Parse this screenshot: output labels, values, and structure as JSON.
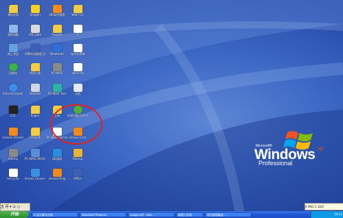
{
  "desktop_icons": [
    {
      "label": "我的文档",
      "icon": "folder-icon",
      "color": "#f2cd43"
    },
    {
      "label": "Qingdin",
      "icon": "app-icon",
      "color": "#f4d21f"
    },
    {
      "label": "360软件管家",
      "icon": "app-icon",
      "color": "#f58b1f"
    },
    {
      "label": "WIN7-CE",
      "icon": "folder-icon",
      "color": "#f2cd43"
    },
    {
      "label": "我的电脑",
      "icon": "computer-icon",
      "color": "#8fb8ee"
    },
    {
      "label": "VID_Data",
      "icon": "app-icon",
      "color": "#d9d9d9"
    },
    {
      "label": "Scopeie",
      "icon": "folder-icon",
      "color": "#f2cd43"
    },
    {
      "label": "2",
      "icon": "document-icon",
      "color": "#ffffff"
    },
    {
      "label": "网上邻居",
      "icon": "network-icon",
      "color": "#67a1e0"
    },
    {
      "label": "印刷车间管理工具",
      "icon": "app-icon",
      "color": "#3e5fb6"
    },
    {
      "label": "Bluetooth",
      "icon": "bluetooth-icon",
      "color": "#2f6fd8"
    },
    {
      "label": "xp中文简体",
      "icon": "document-icon",
      "color": "#ffffff"
    },
    {
      "label": "回收站",
      "icon": "recycle-bin-icon",
      "color": "#3cb34a"
    },
    {
      "label": "实用工具",
      "icon": "folder-icon",
      "color": "#f2cd43"
    },
    {
      "label": "PC-WAIZ",
      "icon": "app-icon",
      "color": "#8a8a8a"
    },
    {
      "label": "wmrt-ce",
      "icon": "document-icon",
      "color": "#ffffff"
    },
    {
      "label": "Internet Explorer",
      "icon": "ie-icon",
      "color": "#3d8ce6"
    },
    {
      "label": "WinDVD",
      "icon": "app-icon",
      "color": "#cfd7e4"
    },
    {
      "label": "PC-WAIZ Tool",
      "icon": "app-icon",
      "color": "#2eb2a6"
    },
    {
      "label": "文档",
      "icon": "word-icon",
      "color": "#e3e9f7"
    },
    {
      "label": "CCC",
      "icon": "app-icon",
      "color": "#222222"
    },
    {
      "label": "Kugoo",
      "icon": "folder-icon",
      "color": "#f2cd43"
    },
    {
      "label": "工具",
      "icon": "folder-icon",
      "color": "#f2cd43"
    },
    {
      "label": "外接设备 DVD Update Client",
      "icon": "update-icon",
      "color": "#4fb03b"
    },
    {
      "label": "Lenovo Drivers",
      "icon": "app-icon",
      "color": "#f08a1f"
    },
    {
      "label": "RTFEdit",
      "icon": "folder-icon",
      "color": "#f2cd43"
    },
    {
      "label": "PC-WAIZ Version",
      "icon": "document-icon",
      "color": "#ffffff"
    },
    {
      "label": "Lenovo Care",
      "icon": "app-icon",
      "color": "#f08a1f"
    },
    {
      "label": "Cdemp",
      "icon": "app-icon",
      "color": "#8a8a8a"
    },
    {
      "label": "PC-WAIZ Wireless",
      "icon": "app-icon",
      "color": "#5a8fd8"
    },
    {
      "label": "QQ游戏",
      "icon": "app-icon",
      "color": "#2b8be0"
    },
    {
      "label": "DSetup",
      "icon": "app-icon",
      "color": "#e9b23b"
    },
    {
      "label": "text_ERL",
      "icon": "document-icon",
      "color": "#ffffff"
    },
    {
      "label": "Access Connections",
      "icon": "app-icon",
      "color": "#3b8fe0"
    },
    {
      "label": "Lenovo Help",
      "icon": "app-icon",
      "color": "#f08a1f"
    },
    {
      "label": "Office",
      "icon": "app-icon",
      "color": "#3d5fb4"
    }
  ],
  "branding": {
    "microsoft": "Microsoft®",
    "windows": "Windows",
    "xp": "xp",
    "edition": "Professional"
  },
  "tray_popup": "4 09/2 1 16/2",
  "language_bar": "五 月 ▾ 三 ○",
  "taskbar": {
    "start_label": "开始",
    "tasks": [
      "2 显示解决方案",
      "Standard Protocol",
      "Ledge.pdf - Ado...",
      "新建工作表",
      "项目经理概述 ..."
    ],
    "clock": "16:31"
  }
}
